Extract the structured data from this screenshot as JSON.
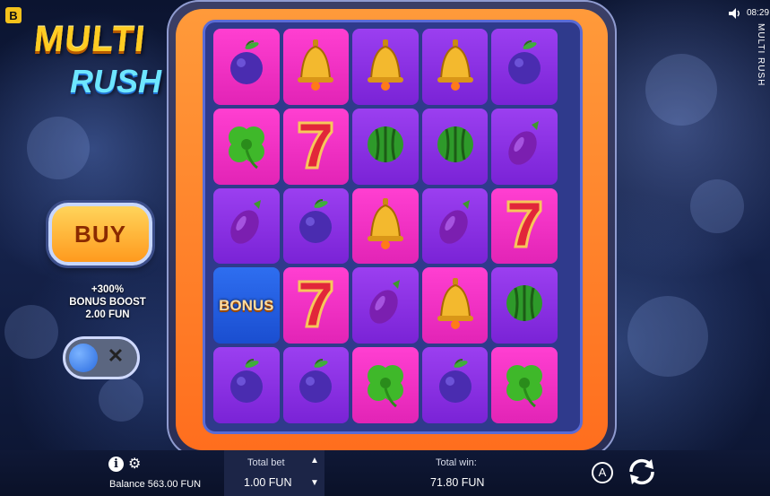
{
  "brand": {
    "badge": "B"
  },
  "logo": {
    "line1": "MULTI",
    "line2": "RUSH"
  },
  "status": {
    "time": "08:29",
    "game_title": "MULTI RUSH"
  },
  "buy": {
    "label": "BUY"
  },
  "bonus_boost": {
    "line1": "+300%",
    "line2": "BONUS BOOST",
    "line3": "2.00 FUN"
  },
  "toggle": {
    "off_symbol": "✕"
  },
  "grid": {
    "rows": [
      [
        {
          "symbol": "plum",
          "bg": "pink"
        },
        {
          "symbol": "bell",
          "bg": "pink"
        },
        {
          "symbol": "bell",
          "bg": "purple"
        },
        {
          "symbol": "bell",
          "bg": "purple"
        },
        {
          "symbol": "plum",
          "bg": "purple"
        }
      ],
      [
        {
          "symbol": "clover",
          "bg": "pink"
        },
        {
          "symbol": "seven",
          "bg": "pink"
        },
        {
          "symbol": "watermelon",
          "bg": "purple"
        },
        {
          "symbol": "watermelon",
          "bg": "purple"
        },
        {
          "symbol": "eggplant",
          "bg": "purple"
        }
      ],
      [
        {
          "symbol": "eggplant",
          "bg": "purple"
        },
        {
          "symbol": "plum",
          "bg": "purple"
        },
        {
          "symbol": "bell",
          "bg": "pink"
        },
        {
          "symbol": "eggplant",
          "bg": "purple"
        },
        {
          "symbol": "seven",
          "bg": "pink"
        }
      ],
      [
        {
          "symbol": "bonus",
          "bg": "blue",
          "label": "BONUS"
        },
        {
          "symbol": "seven",
          "bg": "pink"
        },
        {
          "symbol": "eggplant",
          "bg": "purple"
        },
        {
          "symbol": "bell",
          "bg": "pink"
        },
        {
          "symbol": "watermelon",
          "bg": "purple"
        }
      ],
      [
        {
          "symbol": "plum",
          "bg": "purple"
        },
        {
          "symbol": "plum",
          "bg": "purple"
        },
        {
          "symbol": "clover",
          "bg": "pink"
        },
        {
          "symbol": "plum",
          "bg": "purple"
        },
        {
          "symbol": "clover",
          "bg": "pink"
        }
      ]
    ]
  },
  "footer": {
    "balance_label": "Balance 563.00 FUN",
    "total_bet_label": "Total bet",
    "total_bet_value": "1.00 FUN",
    "total_win_label": "Total win:",
    "total_win_value": "71.80 FUN",
    "auto_label": "A"
  }
}
